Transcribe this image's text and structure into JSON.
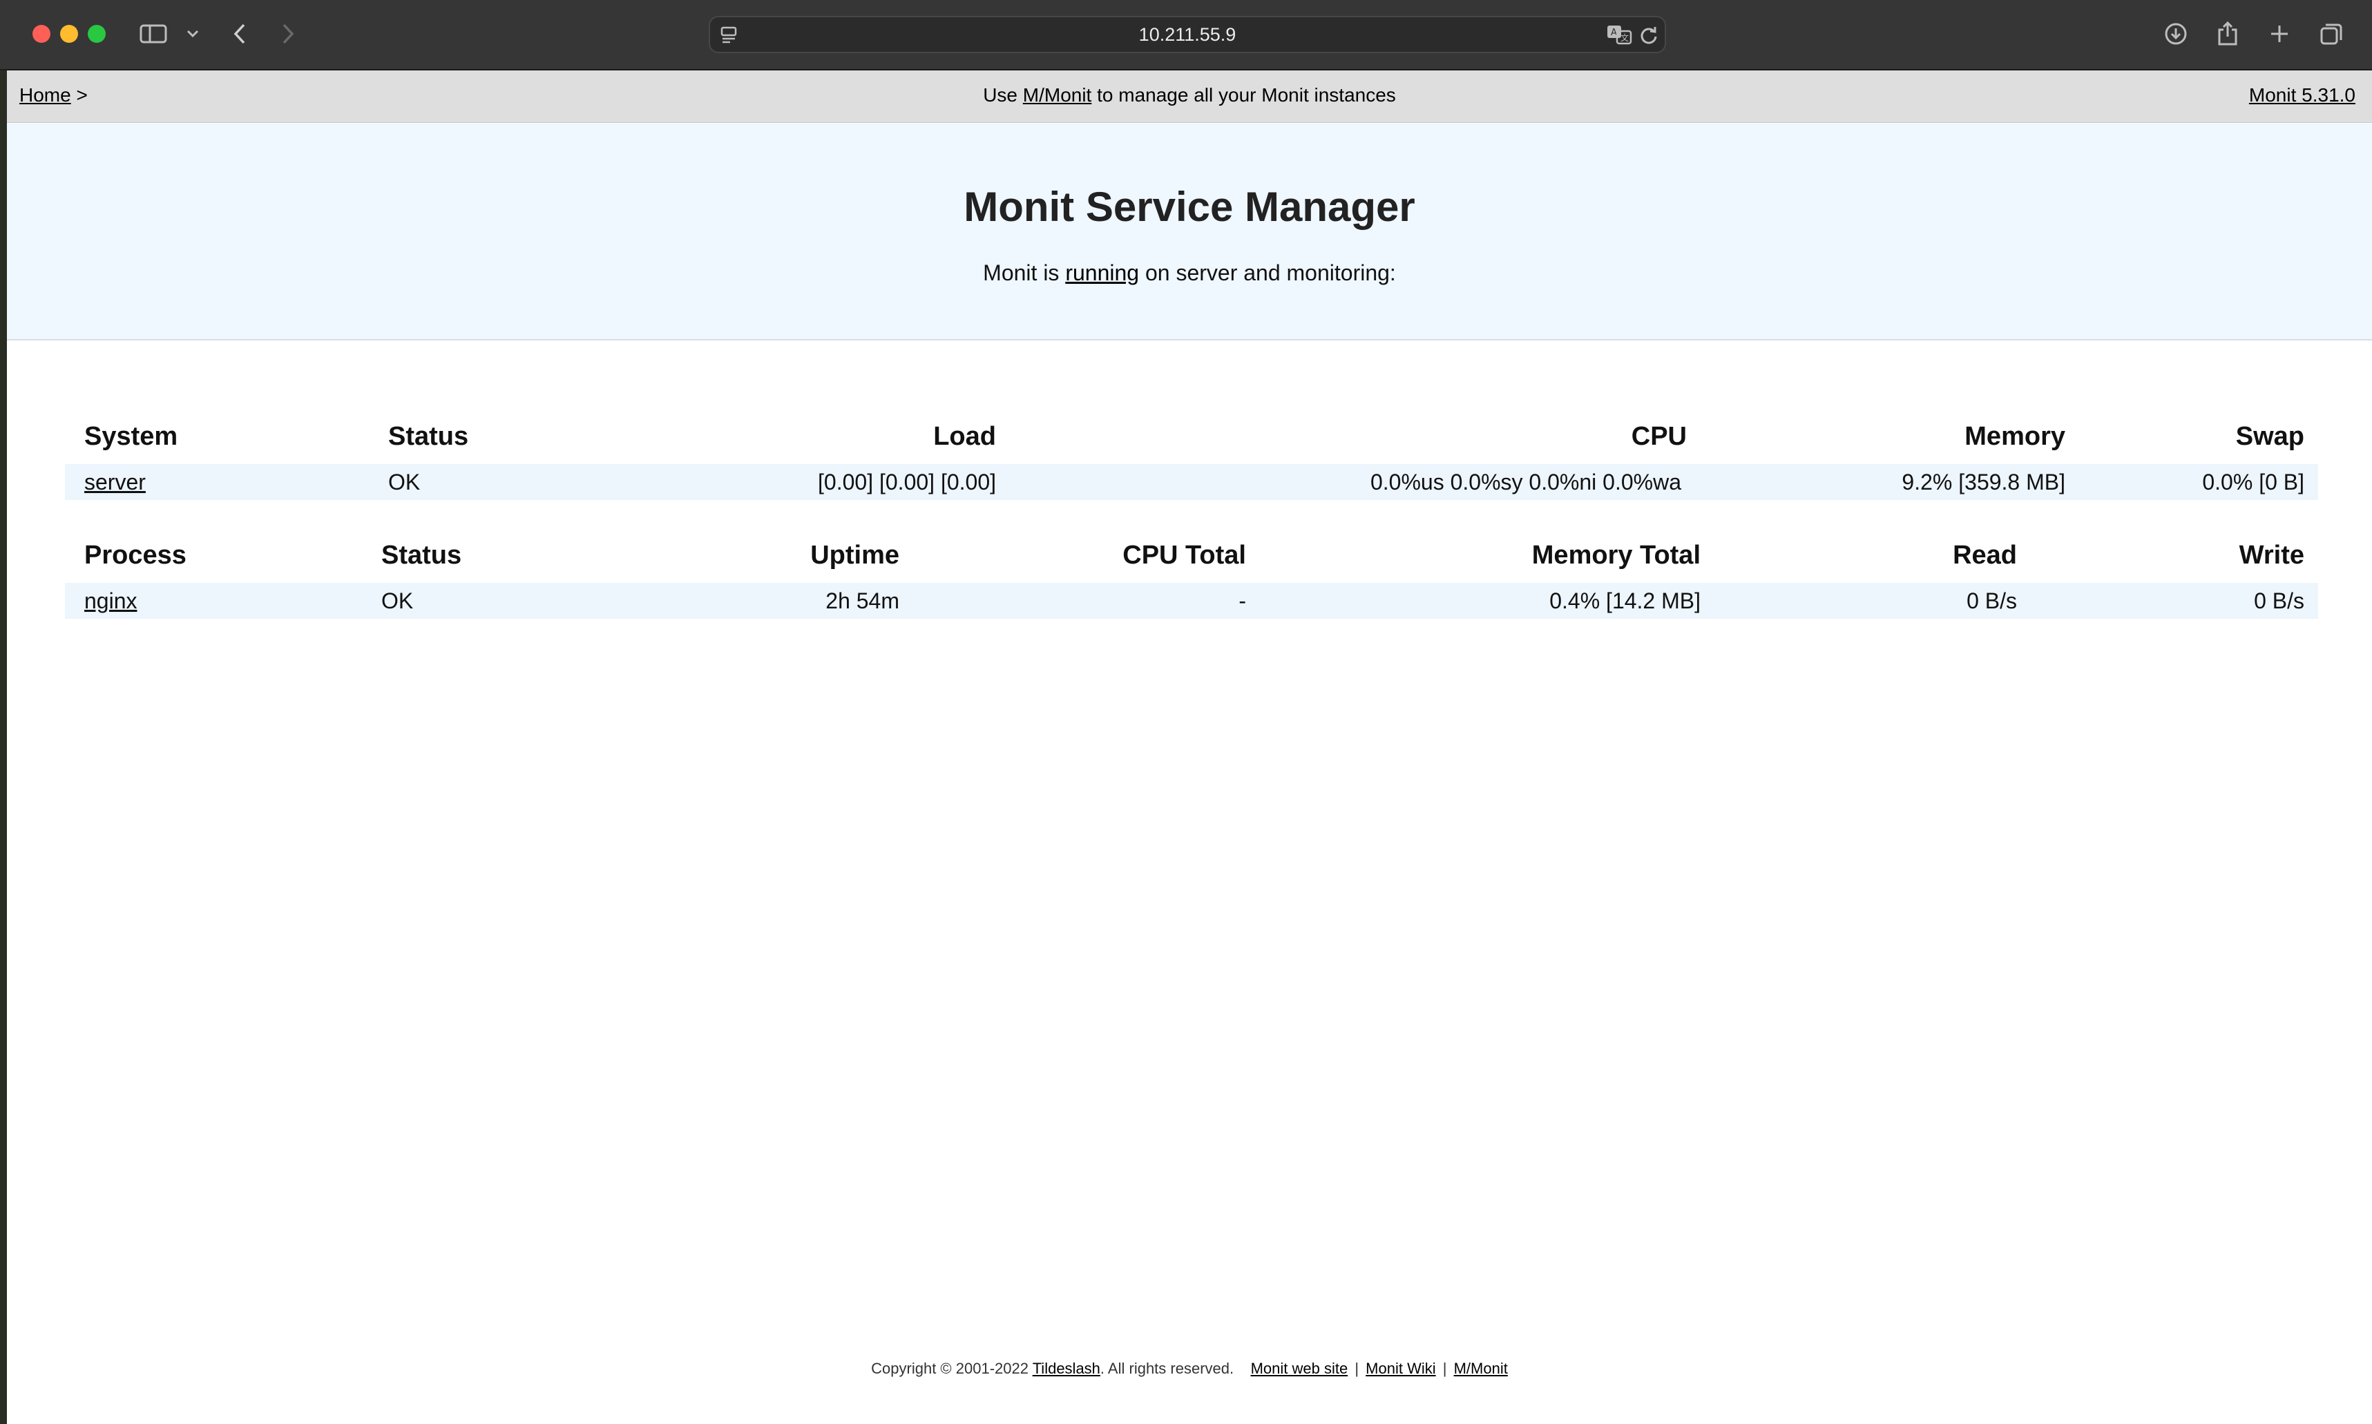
{
  "browser": {
    "url": "10.211.55.9"
  },
  "nav": {
    "home_label": "Home",
    "breadcrumb_sep": ">",
    "promo_prefix": "Use",
    "promo_link": "M/Monit",
    "promo_suffix": "to manage all your Monit instances",
    "version_link": "Monit 5.31.0"
  },
  "header": {
    "title": "Monit Service Manager",
    "status_prefix": "Monit is",
    "status_link": "running",
    "status_suffix": "on server and monitoring:"
  },
  "system_table": {
    "headers": {
      "system": "System",
      "status": "Status",
      "load": "Load",
      "cpu": "CPU",
      "memory": "Memory",
      "swap": "Swap"
    },
    "rows": [
      {
        "name": "server",
        "status": "OK",
        "load": "[0.00] [0.00] [0.00]",
        "cpu": "0.0%us 0.0%sy 0.0%ni 0.0%wa",
        "memory": "9.2% [359.8 MB]",
        "swap": "0.0% [0 B]"
      }
    ]
  },
  "process_table": {
    "headers": {
      "process": "Process",
      "status": "Status",
      "uptime": "Uptime",
      "cpu_total": "CPU Total",
      "memory_total": "Memory Total",
      "read": "Read",
      "write": "Write"
    },
    "rows": [
      {
        "name": "nginx",
        "status": "OK",
        "uptime": "2h 54m",
        "cpu_total": "-",
        "memory_total": "0.4% [14.2 MB]",
        "read": "0 B/s",
        "write": "0 B/s"
      }
    ]
  },
  "footer": {
    "copyright": "Copyright © 2001-2022",
    "company_link": "Tildeslash",
    "rights": ". All rights reserved.",
    "web_site_link": "Monit web site",
    "wiki_link": "Monit Wiki",
    "mmonit_link": "M/Monit",
    "separator": "|"
  },
  "colors": {
    "status_ok": "#4cd62c",
    "header_bg": "#eff7ff",
    "row_bg": "#edf5fd",
    "nav_bg": "#dedede"
  },
  "icons": {
    "sidebar": "sidebar-icon",
    "chevron": "chevron-down-icon",
    "back": "back-arrow-icon",
    "forward": "forward-arrow-icon",
    "page_menu": "page-menu-icon",
    "translate": "translate-icon",
    "reload": "reload-icon",
    "download": "download-icon",
    "share": "share-icon",
    "new_tab": "plus-icon",
    "tabs": "tabs-overview-icon"
  }
}
